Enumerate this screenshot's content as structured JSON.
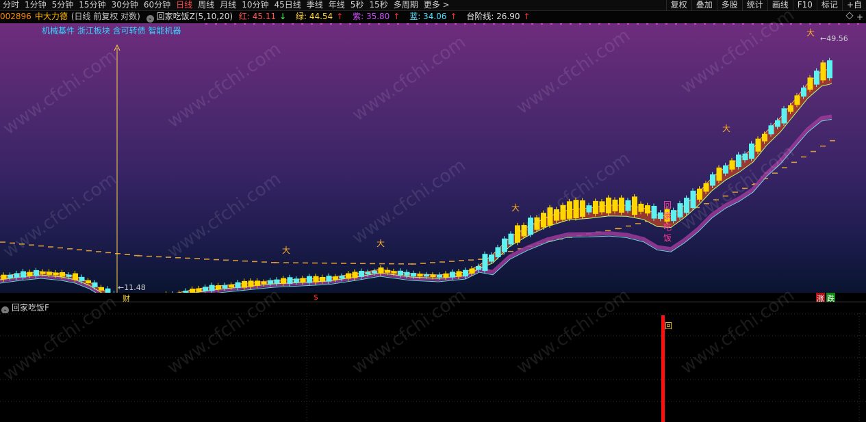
{
  "toolbar": {
    "periods": [
      "分时",
      "1分钟",
      "5分钟",
      "15分钟",
      "30分钟",
      "60分钟",
      "日线",
      "周线",
      "月线",
      "10分钟",
      "45日线",
      "季线",
      "年线",
      "5秒",
      "15秒",
      "多周期",
      "更多 >"
    ],
    "active_period": "日线",
    "right_items": [
      "复权",
      "叠加",
      "多股",
      "统计",
      "画线",
      "F10",
      "标记",
      "+自"
    ]
  },
  "info": {
    "code": "002896",
    "name": "中大力德",
    "period_desc": "(日线 前复权 对数)",
    "indicator_name": "回家吃饭Z(5,10,20)",
    "red_label": "红: 45.11",
    "green_label": "绿: 44.54",
    "purple_label": "紫: 35.80",
    "blue_label": "蓝: 34.06",
    "step_label": "台阶线: 26.90",
    "arrow_down": "↓",
    "arrow_up": "↑"
  },
  "concepts": "机械基件 浙江板块 含可转债 智能机器",
  "chart": {
    "high_label": "49.56",
    "low_label": "11.48",
    "signal_chars": [
      "回",
      "家",
      "吃",
      "饭"
    ],
    "colors": {
      "up": "#ffd700",
      "down": "#5ff0f0",
      "red_band": "#a33a2e",
      "purple_band": "#9b3a9a",
      "step": "#d89a3a"
    }
  },
  "markers": {
    "cai": "财",
    "dollar": "$",
    "zhang": "涨",
    "die": "跌"
  },
  "sub": {
    "title": "回家吃饭F",
    "signal": "回"
  },
  "watermark": "www.cfchi.com"
}
